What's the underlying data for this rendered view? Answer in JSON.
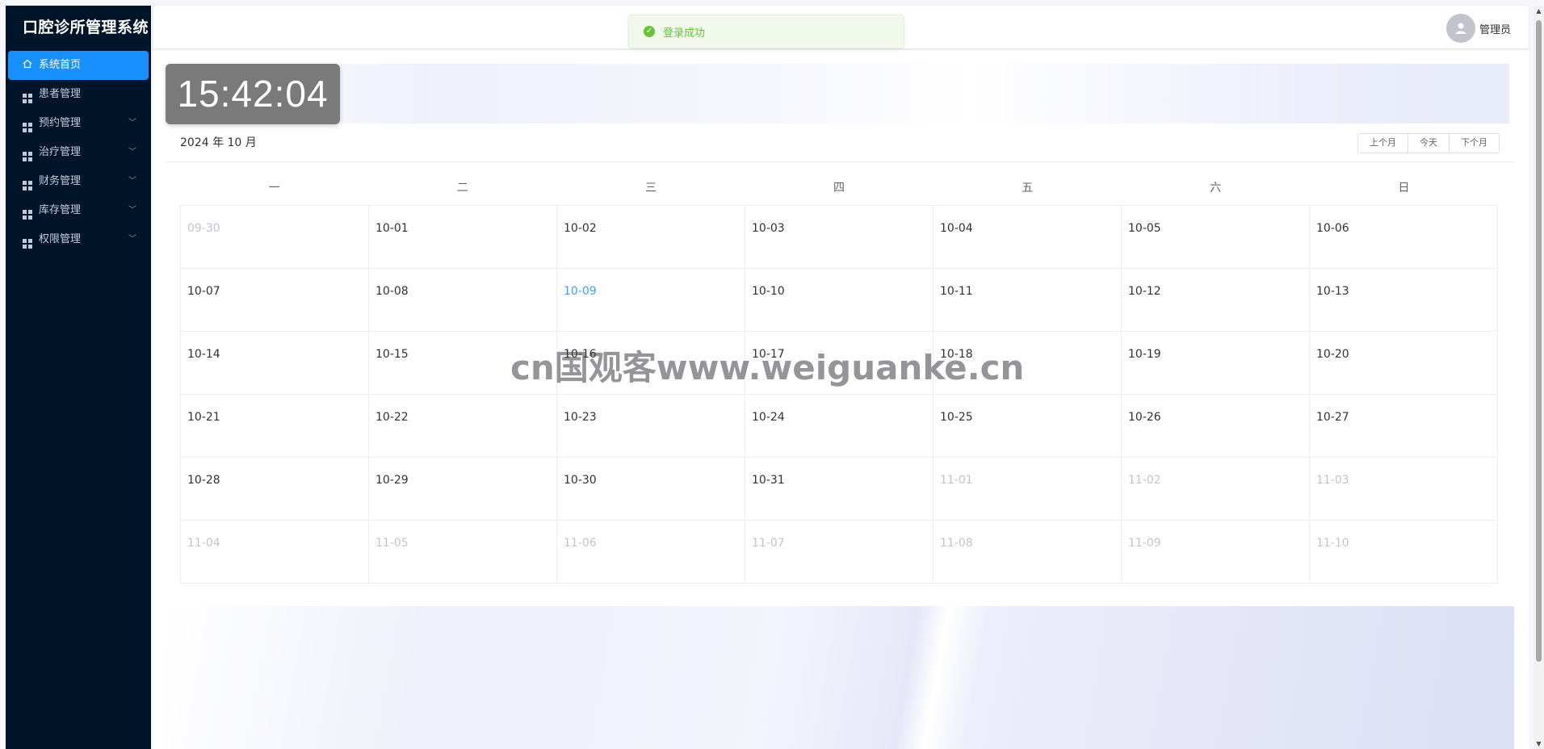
{
  "sidebar": {
    "title": "口腔诊所管理系统",
    "items": [
      {
        "label": "系统首页",
        "icon": "home-icon",
        "active": true
      },
      {
        "label": "患者管理",
        "icon": "grid-icon"
      },
      {
        "label": "预约管理",
        "icon": "grid-icon",
        "expandable": true
      },
      {
        "label": "治疗管理",
        "icon": "grid-icon",
        "expandable": true
      },
      {
        "label": "财务管理",
        "icon": "grid-icon",
        "expandable": true
      },
      {
        "label": "库存管理",
        "icon": "grid-icon",
        "expandable": true
      },
      {
        "label": "权限管理",
        "icon": "grid-icon",
        "expandable": true
      }
    ]
  },
  "header": {
    "user_name": "管理员",
    "avatar_icon": "user-icon"
  },
  "toast": {
    "message": "登录成功",
    "icon": "check-circle-icon",
    "color": "#67c23a"
  },
  "clock": {
    "time": "15:42:04"
  },
  "calendar": {
    "title": "2024 年 10 月",
    "buttons": {
      "prev": "上个月",
      "today": "今天",
      "next": "下个月"
    },
    "weekdays": [
      "一",
      "二",
      "三",
      "四",
      "五",
      "六",
      "日"
    ],
    "today_color": "#409eff",
    "days": [
      {
        "date": "09-30",
        "other": true
      },
      {
        "date": "10-01"
      },
      {
        "date": "10-02"
      },
      {
        "date": "10-03"
      },
      {
        "date": "10-04"
      },
      {
        "date": "10-05"
      },
      {
        "date": "10-06"
      },
      {
        "date": "10-07"
      },
      {
        "date": "10-08"
      },
      {
        "date": "10-09",
        "today": true
      },
      {
        "date": "10-10"
      },
      {
        "date": "10-11"
      },
      {
        "date": "10-12"
      },
      {
        "date": "10-13"
      },
      {
        "date": "10-14"
      },
      {
        "date": "10-15"
      },
      {
        "date": "10-16"
      },
      {
        "date": "10-17"
      },
      {
        "date": "10-18"
      },
      {
        "date": "10-19"
      },
      {
        "date": "10-20"
      },
      {
        "date": "10-21"
      },
      {
        "date": "10-22"
      },
      {
        "date": "10-23"
      },
      {
        "date": "10-24"
      },
      {
        "date": "10-25"
      },
      {
        "date": "10-26"
      },
      {
        "date": "10-27"
      },
      {
        "date": "10-28"
      },
      {
        "date": "10-29"
      },
      {
        "date": "10-30"
      },
      {
        "date": "10-31"
      },
      {
        "date": "11-01",
        "other": true
      },
      {
        "date": "11-02",
        "other": true
      },
      {
        "date": "11-03",
        "other": true
      },
      {
        "date": "11-04",
        "other": true
      },
      {
        "date": "11-05",
        "other": true
      },
      {
        "date": "11-06",
        "other": true
      },
      {
        "date": "11-07",
        "other": true
      },
      {
        "date": "11-08",
        "other": true
      },
      {
        "date": "11-09",
        "other": true
      },
      {
        "date": "11-10",
        "other": true
      }
    ]
  },
  "watermark": "cn国观客www.weiguanke.cn",
  "colors": {
    "sidebar_bg": "#001529",
    "accent": "#1890ff"
  }
}
